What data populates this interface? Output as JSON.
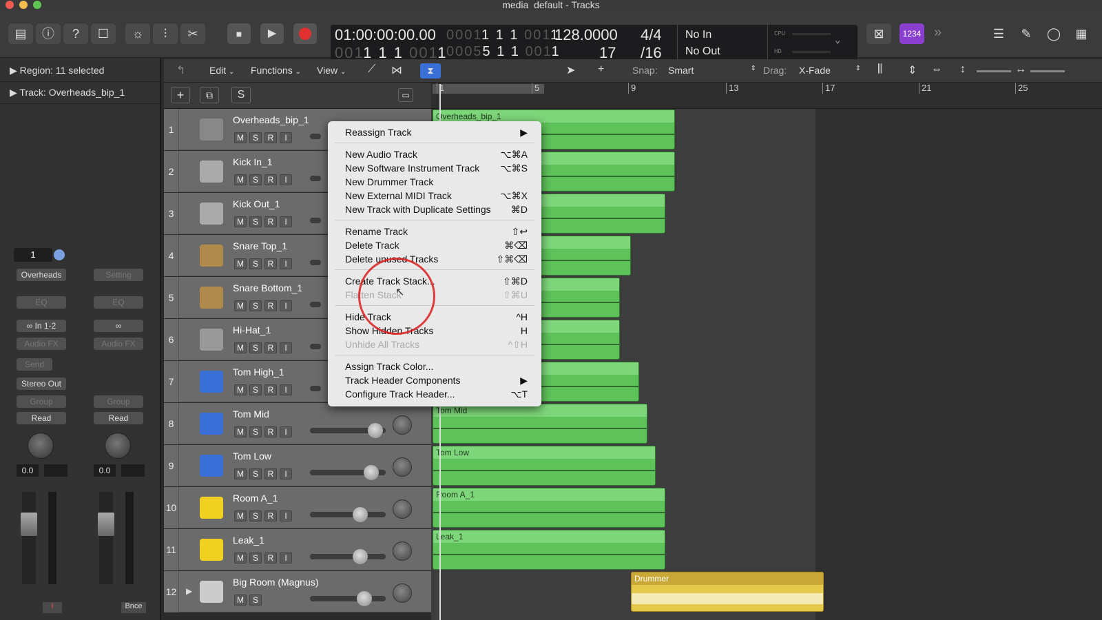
{
  "window": {
    "title": "media_default - Tracks"
  },
  "lcd": {
    "time": "01:00:00:00.00",
    "smpte_dim": "0001",
    "smpte_a": "1",
    "smpte_b": "1",
    "smpte_dim2": "001",
    "smpte_c": "1",
    "bars_beats": "1 1 1",
    "bars_dim": "001",
    "bars_last": "1",
    "end_dim": "0005",
    "end_a": "5",
    "end_b": "1",
    "end_c": "1",
    "end_dim2": "001",
    "end_d": "1",
    "tempo": "128.0000",
    "tempo_sub": "17",
    "sig_top": "4/4",
    "sig_bottom": "/16",
    "midi_in": "No In",
    "midi_out": "No Out",
    "cpu_label": "CPU",
    "hd_label": "HD",
    "count_in": "1234"
  },
  "inspector": {
    "region_label": "Region:",
    "region_value": "11 selected",
    "track_label": "Track:",
    "track_value": "Overheads_bip_1",
    "channel_num": "1",
    "strip1": {
      "setting": "Overheads",
      "eq": "EQ",
      "input": "In 1-2",
      "audio_fx": "Audio FX",
      "send": "Send",
      "output": "Stereo Out",
      "group": "Group",
      "automation": "Read",
      "pan": "0.0",
      "bottom": "I"
    },
    "strip2": {
      "setting": "Setting",
      "eq": "EQ",
      "audio_fx": "Audio FX",
      "group": "Group",
      "automation": "Read",
      "pan": "0.0",
      "bottom": "Bnce"
    }
  },
  "localbar": {
    "edit": "Edit",
    "functions": "Functions",
    "view": "View",
    "snap_label": "Snap:",
    "snap_value": "Smart",
    "drag_label": "Drag:",
    "drag_value": "X-Fade"
  },
  "ruler": {
    "marks": [
      "1",
      "5",
      "9",
      "13",
      "17",
      "21",
      "25"
    ]
  },
  "tracks": [
    {
      "num": "1",
      "name": "Overheads_bip_1",
      "buttons": [
        "M",
        "S",
        "R",
        "I"
      ],
      "color": "#888"
    },
    {
      "num": "2",
      "name": "Kick In_1",
      "buttons": [
        "M",
        "S",
        "R",
        "I"
      ],
      "color": "#aaa"
    },
    {
      "num": "3",
      "name": "Kick Out_1",
      "buttons": [
        "M",
        "S",
        "R",
        "I"
      ],
      "color": "#aaa"
    },
    {
      "num": "4",
      "name": "Snare Top_1",
      "buttons": [
        "M",
        "S",
        "R",
        "I"
      ],
      "color": "#b08a4a"
    },
    {
      "num": "5",
      "name": "Snare Bottom_1",
      "buttons": [
        "M",
        "S",
        "R",
        "I"
      ],
      "color": "#b08a4a"
    },
    {
      "num": "6",
      "name": "Hi-Hat_1",
      "buttons": [
        "M",
        "S",
        "R",
        "I"
      ],
      "color": "#999"
    },
    {
      "num": "7",
      "name": "Tom High_1",
      "buttons": [
        "M",
        "S",
        "R",
        "I"
      ],
      "color": "#3a6fd8"
    },
    {
      "num": "8",
      "name": "Tom Mid",
      "buttons": [
        "M",
        "S",
        "R",
        "I"
      ],
      "color": "#3a6fd8"
    },
    {
      "num": "9",
      "name": "Tom Low",
      "buttons": [
        "M",
        "S",
        "R",
        "I"
      ],
      "color": "#3a6fd8"
    },
    {
      "num": "10",
      "name": "Room A_1",
      "buttons": [
        "M",
        "S",
        "R",
        "I"
      ],
      "color": "#f0d020"
    },
    {
      "num": "11",
      "name": "Leak_1",
      "buttons": [
        "M",
        "S",
        "R",
        "I"
      ],
      "color": "#f0d020"
    },
    {
      "num": "12",
      "name": "Big Room (Magnus)",
      "buttons": [
        "M",
        "S"
      ],
      "color": "#ccc"
    }
  ],
  "regions": [
    {
      "name": "Overheads_bip_1"
    },
    {
      "name": ""
    },
    {
      "name": ""
    },
    {
      "name": ""
    },
    {
      "name": ""
    },
    {
      "name": ""
    },
    {
      "name": ""
    },
    {
      "name": "Tom Mid"
    },
    {
      "name": "Tom Low"
    },
    {
      "name": "Room A_1"
    },
    {
      "name": "Leak_1"
    },
    {
      "name": "Drummer"
    }
  ],
  "context_menu": {
    "items": [
      {
        "label": "Reassign Track",
        "shortcut": "▶",
        "disabled": false
      },
      {
        "label": "New Audio Track",
        "shortcut": "⌥⌘A",
        "disabled": false
      },
      {
        "label": "New Software Instrument Track",
        "shortcut": "⌥⌘S",
        "disabled": false
      },
      {
        "label": "New Drummer Track",
        "shortcut": "",
        "disabled": false
      },
      {
        "label": "New External MIDI Track",
        "shortcut": "⌥⌘X",
        "disabled": false
      },
      {
        "label": "New Track with Duplicate Settings",
        "shortcut": "⌘D",
        "disabled": false
      },
      {
        "label": "Rename Track",
        "shortcut": "⇧↩",
        "disabled": false
      },
      {
        "label": "Delete Track",
        "shortcut": "⌘⌫",
        "disabled": false
      },
      {
        "label": "Delete unused Tracks",
        "shortcut": "⇧⌘⌫",
        "disabled": false
      },
      {
        "label": "Create Track Stack...",
        "shortcut": "⇧⌘D",
        "disabled": false
      },
      {
        "label": "Flatten Stack",
        "shortcut": "⇧⌘U",
        "disabled": true
      },
      {
        "label": "Hide Track",
        "shortcut": "^H",
        "disabled": false
      },
      {
        "label": "Show Hidden Tracks",
        "shortcut": "H",
        "disabled": false
      },
      {
        "label": "Unhide All Tracks",
        "shortcut": "^⇧H",
        "disabled": true
      },
      {
        "label": "Assign Track Color...",
        "shortcut": "",
        "disabled": false
      },
      {
        "label": "Track Header Components",
        "shortcut": "▶",
        "disabled": false
      },
      {
        "label": "Configure Track Header...",
        "shortcut": "⌥T",
        "disabled": false
      }
    ]
  },
  "colors": {
    "region_green": "#5ec25a",
    "drummer_yellow": "#e6c84a",
    "record_red": "#e03030",
    "count_in_purple": "#8a3fd0"
  }
}
